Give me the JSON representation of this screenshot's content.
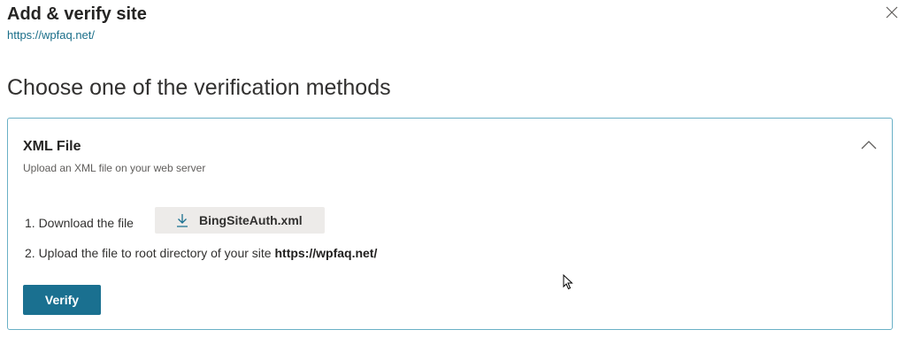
{
  "dialog": {
    "title": "Add & verify site",
    "site_url": "https://wpfaq.net/",
    "heading": "Choose one of the verification methods"
  },
  "method": {
    "title": "XML File",
    "description": "Upload an XML file on your web server",
    "step1_text": "1. Download the file",
    "download_label": "BingSiteAuth.xml",
    "step2_text": "2. Upload the file to root directory of your site",
    "step2_url": "https://wpfaq.net/",
    "verify_label": "Verify"
  },
  "icons": {
    "close": "close-icon",
    "collapse": "chevron-up-icon",
    "download": "download-icon",
    "cursor": "mouse-pointer-icon"
  },
  "colors": {
    "accent": "#1a7090",
    "link": "#1b6f8a",
    "panel_border": "#6ab0c6",
    "download_bg": "#edebe9"
  }
}
